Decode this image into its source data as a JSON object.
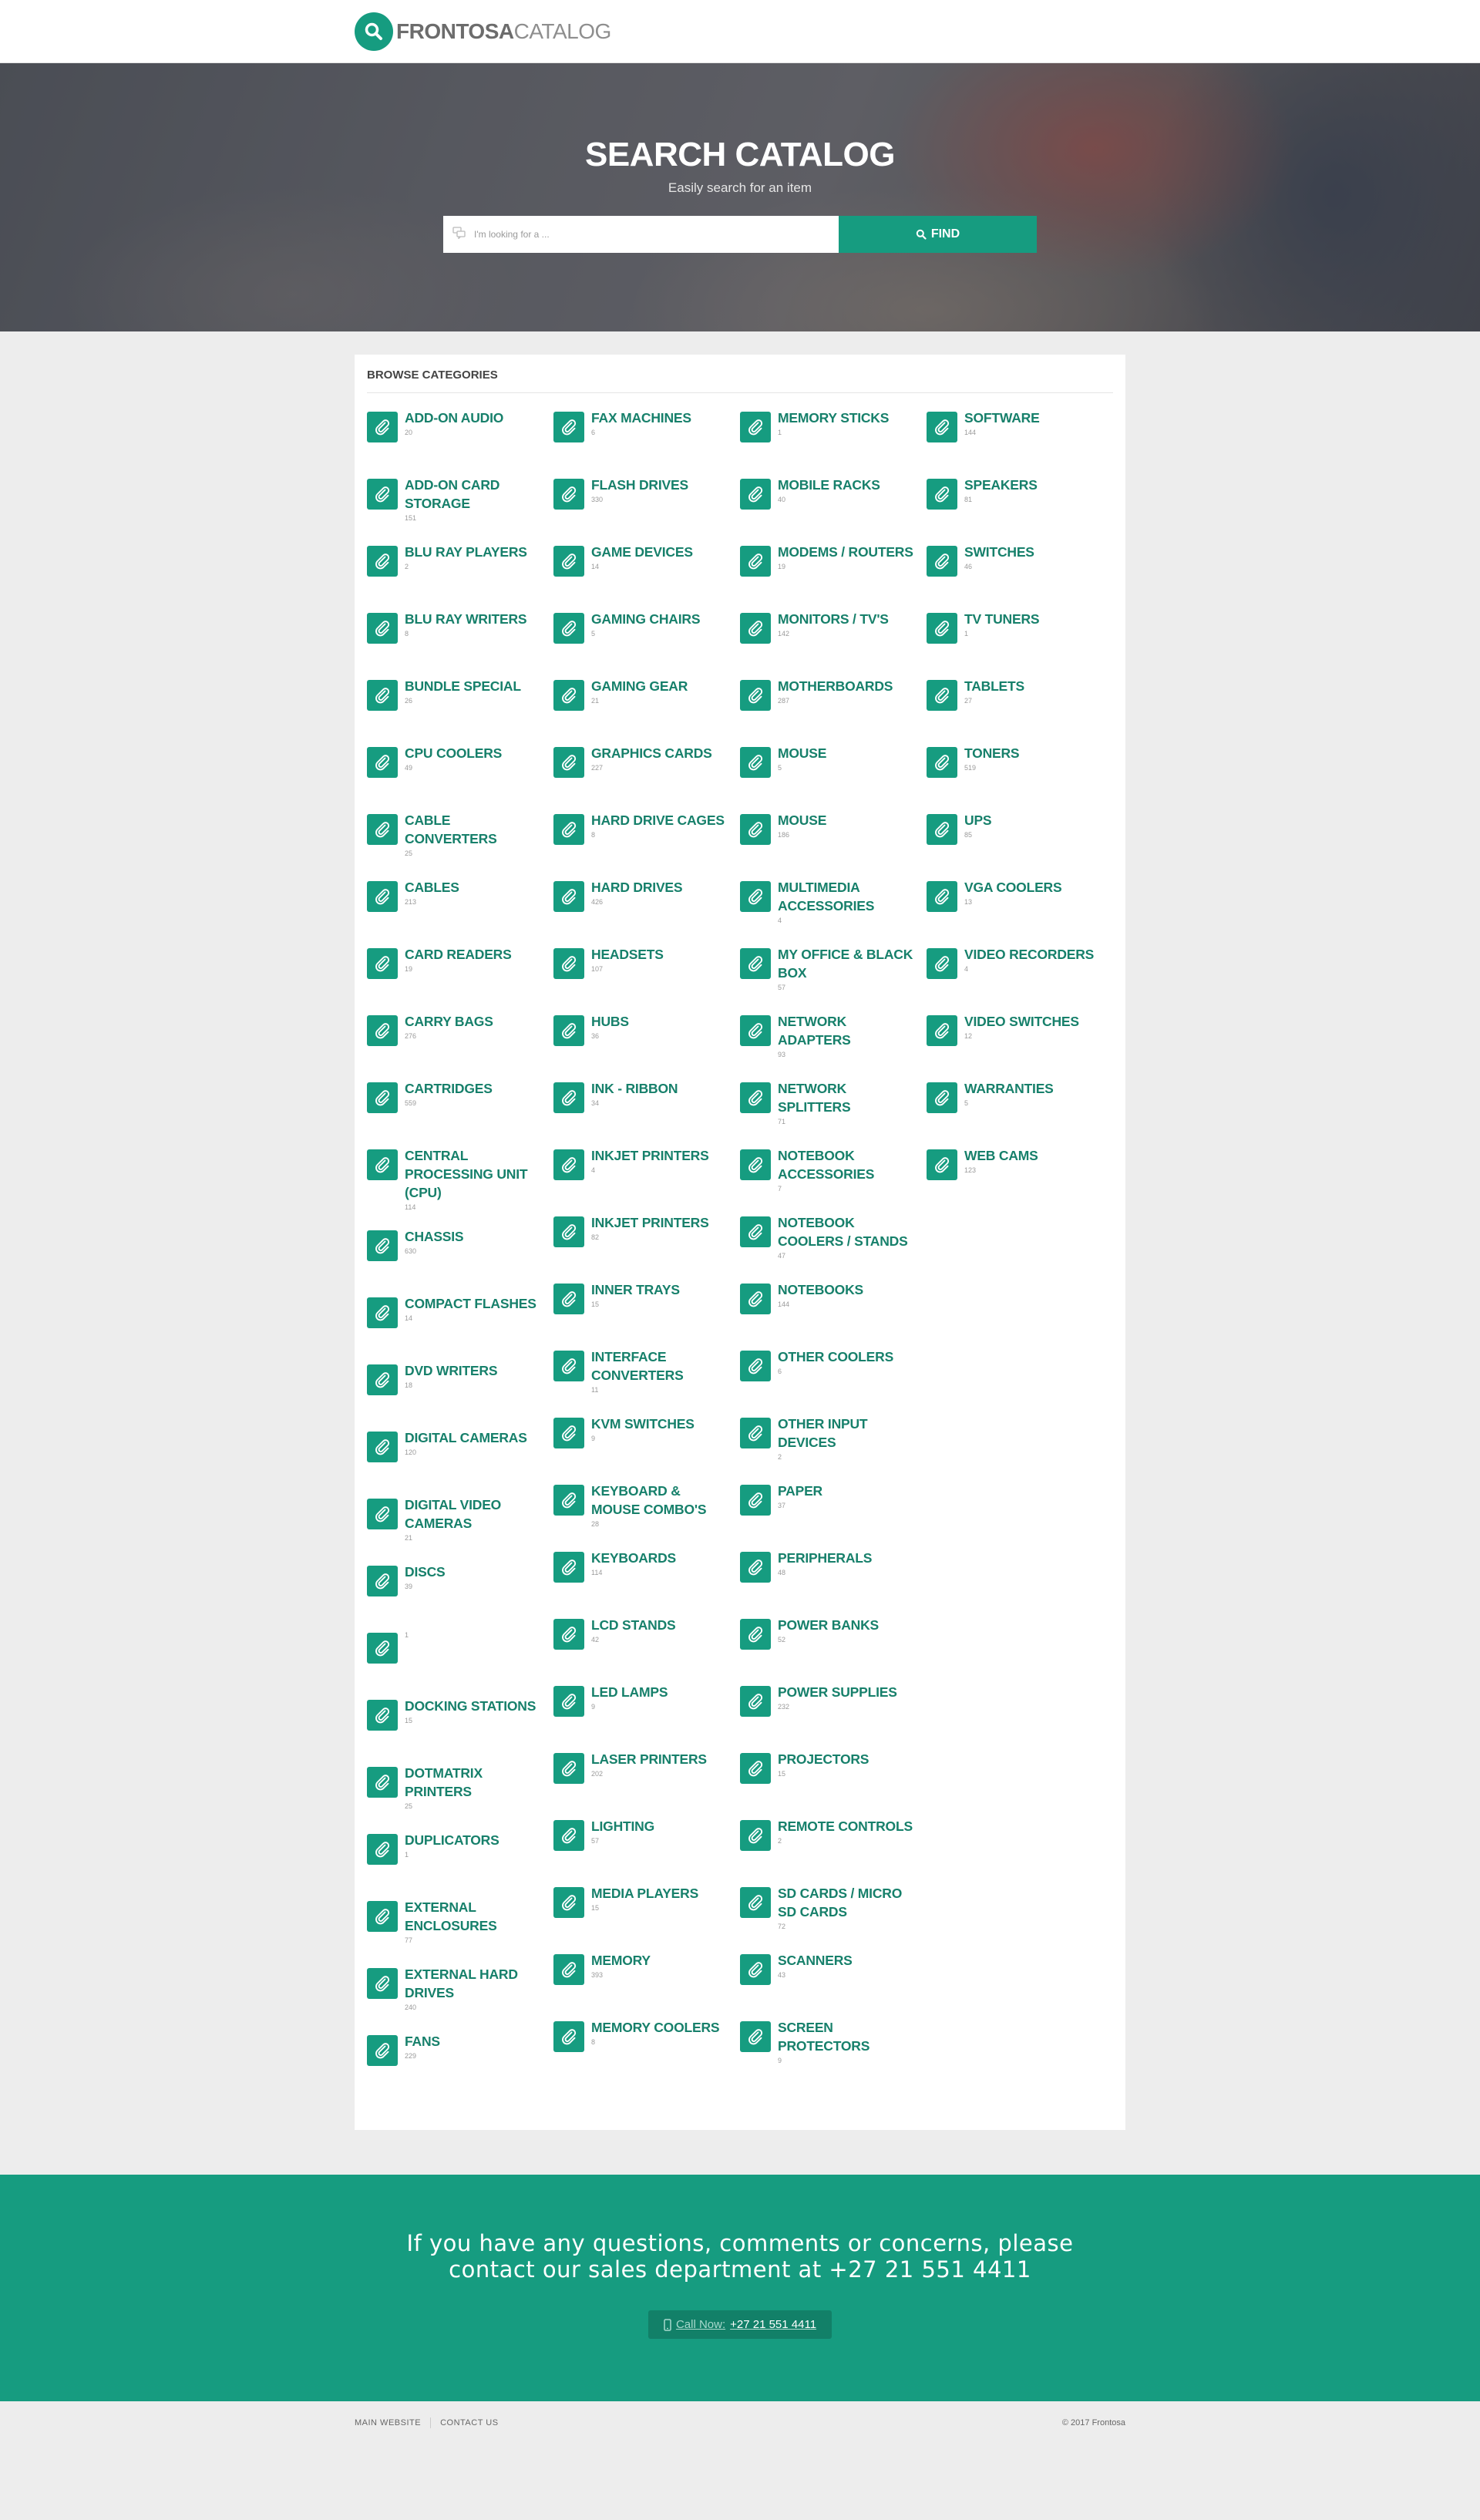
{
  "brand": {
    "bold": "FRONTOSA",
    "light": "CATALOG"
  },
  "hero": {
    "title": "SEARCH CATALOG",
    "subtitle": "Easily search for an item",
    "placeholder": "I'm looking for a ...",
    "find_label": "FIND"
  },
  "panel": {
    "title": "BROWSE CATEGORIES"
  },
  "columns": [
    [
      {
        "name": "ADD-ON AUDIO",
        "count": "20"
      },
      {
        "name": "ADD-ON CARD STORAGE",
        "count": "151"
      },
      {
        "name": "BLU RAY PLAYERS",
        "count": "2"
      },
      {
        "name": "BLU RAY WRITERS",
        "count": "8"
      },
      {
        "name": "BUNDLE SPECIAL",
        "count": "26"
      },
      {
        "name": "CPU COOLERS",
        "count": "49"
      },
      {
        "name": "CABLE CONVERTERS",
        "count": "25"
      },
      {
        "name": "CABLES",
        "count": "213"
      },
      {
        "name": "CARD READERS",
        "count": "19"
      },
      {
        "name": "CARRY BAGS",
        "count": "276"
      },
      {
        "name": "CARTRIDGES",
        "count": "559"
      },
      {
        "name": "CENTRAL PROCESSING UNIT (CPU)",
        "count": "114"
      },
      {
        "name": "CHASSIS",
        "count": "630"
      },
      {
        "name": "COMPACT FLASHES",
        "count": "14"
      },
      {
        "name": "DVD WRITERS",
        "count": "18"
      },
      {
        "name": "DIGITAL CAMERAS",
        "count": "120"
      },
      {
        "name": "DIGITAL VIDEO CAMERAS",
        "count": "21"
      },
      {
        "name": "DISCS",
        "count": "39"
      },
      {
        "name": "",
        "count": "1"
      },
      {
        "name": "DOCKING STATIONS",
        "count": "15"
      },
      {
        "name": "DOTMATRIX PRINTERS",
        "count": "25"
      },
      {
        "name": "DUPLICATORS",
        "count": "1"
      },
      {
        "name": "EXTERNAL ENCLOSURES",
        "count": "77"
      },
      {
        "name": "EXTERNAL HARD DRIVES",
        "count": "240"
      },
      {
        "name": "FANS",
        "count": "229"
      }
    ],
    [
      {
        "name": "FAX MACHINES",
        "count": "6"
      },
      {
        "name": "FLASH DRIVES",
        "count": "330"
      },
      {
        "name": "GAME DEVICES",
        "count": "14"
      },
      {
        "name": "GAMING CHAIRS",
        "count": "5"
      },
      {
        "name": "GAMING GEAR",
        "count": "21"
      },
      {
        "name": "GRAPHICS CARDS",
        "count": "227"
      },
      {
        "name": "HARD DRIVE CAGES",
        "count": "8"
      },
      {
        "name": "HARD DRIVES",
        "count": "426"
      },
      {
        "name": "HEADSETS",
        "count": "107"
      },
      {
        "name": "HUBS",
        "count": "36"
      },
      {
        "name": "INK - RIBBON",
        "count": "34"
      },
      {
        "name": "INKJET PRINTERS",
        "count": "4"
      },
      {
        "name": "INKJET PRINTERS",
        "count": "82"
      },
      {
        "name": "INNER TRAYS",
        "count": "15"
      },
      {
        "name": "INTERFACE CONVERTERS",
        "count": "11"
      },
      {
        "name": "KVM SWITCHES",
        "count": "9"
      },
      {
        "name": "KEYBOARD & MOUSE COMBO'S",
        "count": "28"
      },
      {
        "name": "KEYBOARDS",
        "count": "114"
      },
      {
        "name": "LCD STANDS",
        "count": "42"
      },
      {
        "name": "LED LAMPS",
        "count": "9"
      },
      {
        "name": "LASER PRINTERS",
        "count": "202"
      },
      {
        "name": "LIGHTING",
        "count": "57"
      },
      {
        "name": "MEDIA PLAYERS",
        "count": "15"
      },
      {
        "name": "MEMORY",
        "count": "393"
      },
      {
        "name": "MEMORY COOLERS",
        "count": "8"
      }
    ],
    [
      {
        "name": "MEMORY STICKS",
        "count": "1"
      },
      {
        "name": "MOBILE RACKS",
        "count": "40"
      },
      {
        "name": "MODEMS / ROUTERS",
        "count": "19"
      },
      {
        "name": "MONITORS / TV'S",
        "count": "142"
      },
      {
        "name": "MOTHERBOARDS",
        "count": "287"
      },
      {
        "name": "MOUSE",
        "count": "5"
      },
      {
        "name": "MOUSE",
        "count": "186"
      },
      {
        "name": "MULTIMEDIA ACCESSORIES",
        "count": "4"
      },
      {
        "name": "MY OFFICE & BLACK BOX",
        "count": "57"
      },
      {
        "name": "NETWORK ADAPTERS",
        "count": "93"
      },
      {
        "name": "NETWORK SPLITTERS",
        "count": "71"
      },
      {
        "name": "NOTEBOOK ACCESSORIES",
        "count": "7"
      },
      {
        "name": "NOTEBOOK COOLERS / STANDS",
        "count": "47"
      },
      {
        "name": "NOTEBOOKS",
        "count": "144"
      },
      {
        "name": "OTHER COOLERS",
        "count": "6"
      },
      {
        "name": "OTHER INPUT DEVICES",
        "count": "2"
      },
      {
        "name": "PAPER",
        "count": "37"
      },
      {
        "name": "PERIPHERALS",
        "count": "48"
      },
      {
        "name": "POWER BANKS",
        "count": "52"
      },
      {
        "name": "POWER SUPPLIES",
        "count": "232"
      },
      {
        "name": "PROJECTORS",
        "count": "15"
      },
      {
        "name": "REMOTE CONTROLS",
        "count": "2"
      },
      {
        "name": "SD CARDS / MICRO SD CARDS",
        "count": "72"
      },
      {
        "name": "SCANNERS",
        "count": "43"
      },
      {
        "name": "SCREEN PROTECTORS",
        "count": "9"
      }
    ],
    [
      {
        "name": "SOFTWARE",
        "count": "144"
      },
      {
        "name": "SPEAKERS",
        "count": "81"
      },
      {
        "name": "SWITCHES",
        "count": "46"
      },
      {
        "name": "TV TUNERS",
        "count": "1"
      },
      {
        "name": "TABLETS",
        "count": "27"
      },
      {
        "name": "TONERS",
        "count": "519"
      },
      {
        "name": "UPS",
        "count": "85"
      },
      {
        "name": "VGA COOLERS",
        "count": "13"
      },
      {
        "name": "VIDEO RECORDERS",
        "count": "4"
      },
      {
        "name": "VIDEO SWITCHES",
        "count": "12"
      },
      {
        "name": "WARRANTIES",
        "count": "5"
      },
      {
        "name": "WEB CAMS",
        "count": "123"
      }
    ]
  ],
  "cta": {
    "line1": "If you have any questions, comments or concerns, please",
    "line2": "contact our sales department at +27 21 551 4411",
    "call_label": "Call Now:",
    "call_number": "+27 21 551 4411"
  },
  "footer": {
    "link1": "MAIN WEBSITE",
    "link2": "CONTACT US",
    "copyright": "© 2017 Frontosa"
  },
  "colors": {
    "accent": "#169c80",
    "link": "#17806b"
  }
}
